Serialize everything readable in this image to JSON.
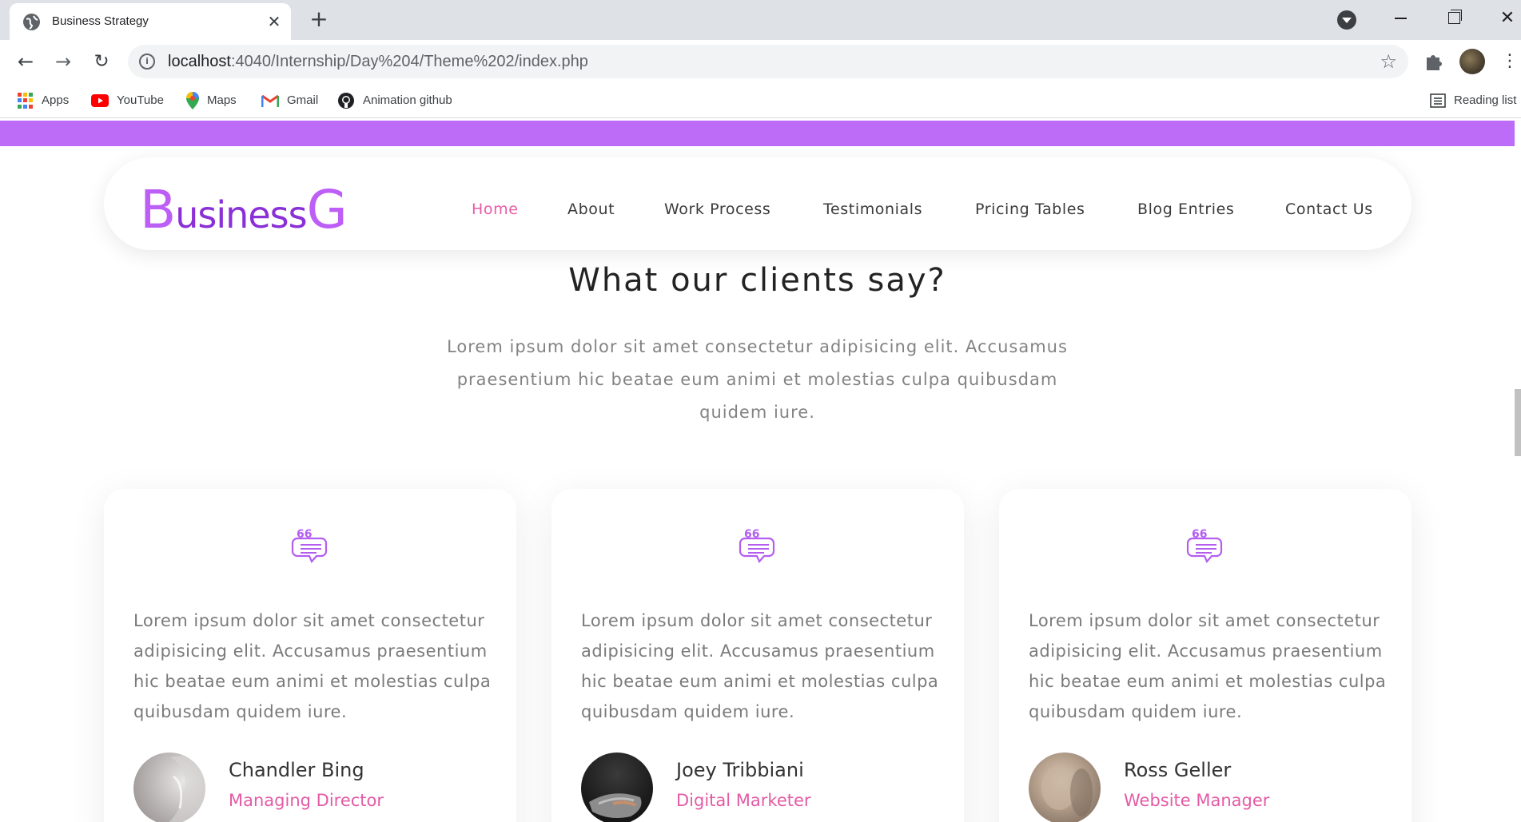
{
  "browser": {
    "tab_title": "Business Strategy",
    "tab_close_glyph": "✕",
    "new_tab_glyph": "+",
    "url_host": "localhost",
    "url_path": ":4040/Internship/Day%204/Theme%202/index.php",
    "bookmarks": [
      {
        "label": "Apps",
        "icon": "apps-grid-icon"
      },
      {
        "label": "YouTube",
        "icon": "youtube-icon"
      },
      {
        "label": "Maps",
        "icon": "maps-pin-icon"
      },
      {
        "label": "Gmail",
        "icon": "gmail-icon"
      },
      {
        "label": "Animation github",
        "icon": "github-icon"
      }
    ],
    "reading_list_label": "Reading list"
  },
  "site": {
    "logo_letter_1": "B",
    "logo_part_1": "usiness",
    "logo_letter_2": "G",
    "nav": [
      {
        "label": "Home",
        "active": true
      },
      {
        "label": "About",
        "active": false
      },
      {
        "label": "Work Process",
        "active": false
      },
      {
        "label": "Testimonials",
        "active": false
      },
      {
        "label": "Pricing Tables",
        "active": false
      },
      {
        "label": "Blog Entries",
        "active": false
      },
      {
        "label": "Contact Us",
        "active": false
      }
    ]
  },
  "testimonials": {
    "title": "What our clients say?",
    "intro": "Lorem ipsum dolor sit amet consectetur adipisicing elit. Accusamus praesentium hic beatae eum animi et molestias culpa quibusdam quidem iure.",
    "cards": [
      {
        "quote": "Lorem ipsum dolor sit amet consectetur adipisicing elit. Accusamus praesentium hic beatae eum animi et molestias culpa quibusdam quidem iure.",
        "name": "Chandler Bing",
        "role": "Managing Director"
      },
      {
        "quote": "Lorem ipsum dolor sit amet consectetur adipisicing elit. Accusamus praesentium hic beatae eum animi et molestias culpa quibusdam quidem iure.",
        "name": "Joey Tribbiani",
        "role": "Digital Marketer"
      },
      {
        "quote": "Lorem ipsum dolor sit amet consectetur adipisicing elit. Accusamus praesentium hic beatae eum animi et molestias culpa quibusdam quidem iure.",
        "name": "Ross Geller",
        "role": "Website Manager"
      }
    ]
  },
  "colors": {
    "accent_purple": "#bd6cf8",
    "logo_dark_purple": "#8b2fd6",
    "accent_pink": "#e85ca6",
    "quote_icon": "#b45ef0"
  }
}
